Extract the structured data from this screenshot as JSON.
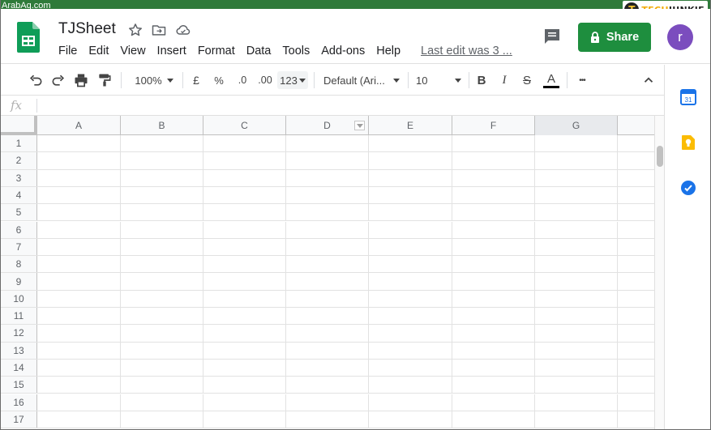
{
  "watermark": {
    "left": "ArabAq.com",
    "right_badge": "T",
    "right_tech": "TECH",
    "right_junkie": "JUNKIE"
  },
  "header": {
    "title": "TJSheet",
    "menu": [
      "File",
      "Edit",
      "View",
      "Insert",
      "Format",
      "Data",
      "Tools",
      "Add-ons",
      "Help"
    ],
    "last_edit": "Last edit was 3 ...",
    "share_label": "Share",
    "avatar_letter": "r",
    "share_color": "#1e8e3e",
    "avatar_color": "#7b4dbe"
  },
  "toolbar": {
    "zoom": "100%",
    "currency": "£",
    "percent": "%",
    "decrease_decimal": ".0",
    "increase_decimal": ".00",
    "more_formats": "123",
    "font": "Default (Ari...",
    "font_size": "10",
    "bold": "B",
    "italic": "I",
    "strike": "S",
    "text_color": "A",
    "more": "•••"
  },
  "formula_bar": {
    "fx": "fx"
  },
  "grid": {
    "columns": [
      "A",
      "B",
      "C",
      "D",
      "E",
      "F",
      "G"
    ],
    "selected_column": "G",
    "rows": [
      "1",
      "2",
      "3",
      "4",
      "5",
      "6",
      "7",
      "8",
      "9",
      "10",
      "11",
      "12",
      "13",
      "14",
      "15",
      "16",
      "17"
    ]
  },
  "side_panel": {
    "icons": [
      "calendar-icon",
      "keep-icon",
      "tasks-icon"
    ],
    "calendar_day": "31"
  }
}
